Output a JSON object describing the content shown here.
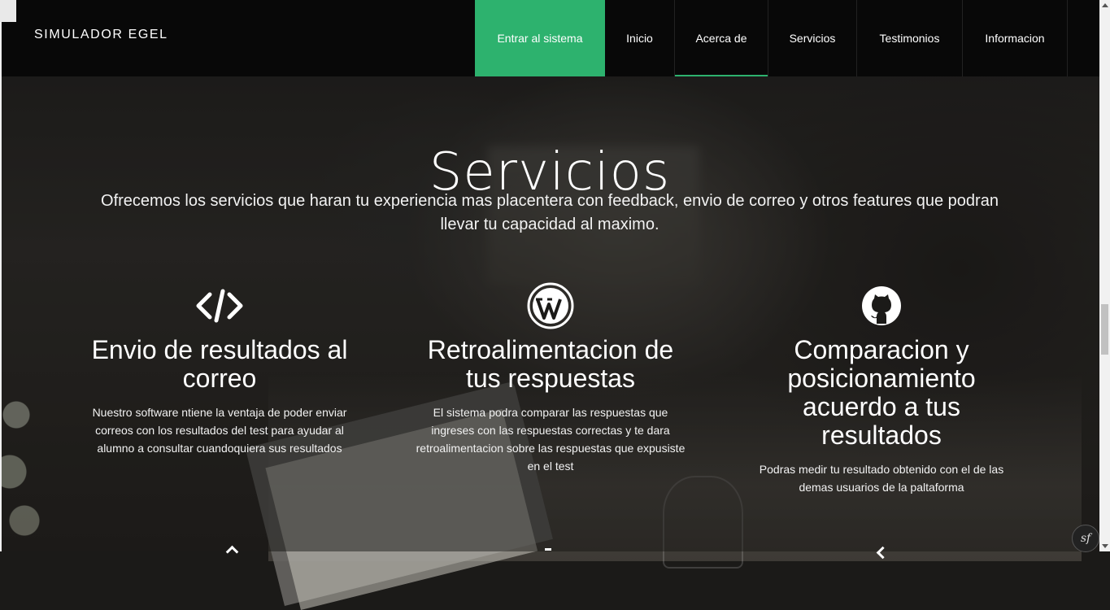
{
  "brand": "SIMULADOR EGEL",
  "nav": {
    "items": [
      {
        "label": "Entrar al sistema"
      },
      {
        "label": "Inicio"
      },
      {
        "label": "Acerca de"
      },
      {
        "label": "Servicios"
      },
      {
        "label": "Testimonios"
      },
      {
        "label": "Informacion"
      }
    ],
    "active": "Acerca de"
  },
  "section": {
    "title": "Servicios",
    "subtitle": "Ofrecemos los servicios que haran tu experiencia mas placentera con feedback, envio de correo y otros features que podran llevar tu capacidad al maximo."
  },
  "services": [
    {
      "icon": "code-icon",
      "title": "Envio de resultados al correo",
      "text": "Nuestro software ntiene la ventaja de poder enviar correos con los resultados del test para ayudar al alumno a consultar cuandoquiera sus resultados"
    },
    {
      "icon": "wordpress-icon",
      "title": "Retroalimentacion de tus respuestas",
      "text": "El sistema podra comparar las respuestas que ingreses con las respuestas correctas y te dara retroalimentacion sobre las respuestas que expusiste en el test"
    },
    {
      "icon": "github-icon",
      "title": "Comparacion y posicionamiento acuerdo a tus resultados",
      "text": "Podras medir tu resultado obtenido con el de las demas usuarios de la paltaforma"
    }
  ],
  "badge": {
    "label": "sf"
  },
  "colors": {
    "accent": "#2db26e",
    "navbar": "#080808"
  }
}
